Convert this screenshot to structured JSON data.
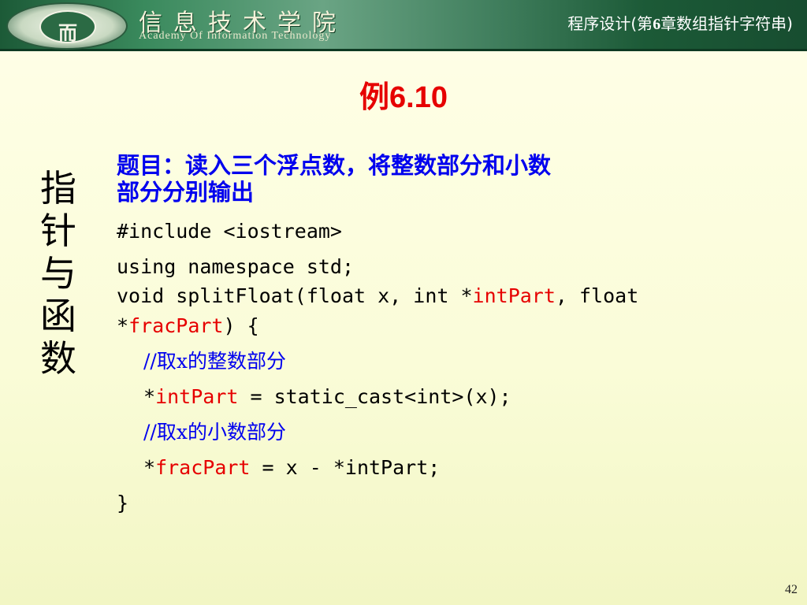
{
  "header": {
    "logo_glyph": "而",
    "school_name": "信息技术学院",
    "school_name_en": "Academy Of Information Technology",
    "chapter_prefix": "程序设计(第",
    "chapter_num": "6",
    "chapter_suffix": "章数组指针字符串)"
  },
  "slide": {
    "title_cn": "例",
    "title_num": "6.10",
    "side_label": [
      "指",
      "针",
      "与",
      "函",
      "数"
    ],
    "question_line1": "题目：读入三个浮点数，将整数部分和小数",
    "question_line2": "部分分别输出",
    "code": {
      "l1": "#include <iostream>",
      "l2": "using namespace std;",
      "l3a": "void splitFloat(float x, int *",
      "l3b": "intPart",
      "l3c": ", float",
      "l4a": "*",
      "l4b": "fracPart",
      "l4c": ") {",
      "l5": "//取x的整数部分",
      "l6a": "*",
      "l6b": "intPart",
      "l6c": " = static_cast<int>(x);",
      "l7": "//取x的小数部分",
      "l8a": "*",
      "l8b": "fracPart",
      "l8c": " = x - *intPart;",
      "l9": "}"
    },
    "page_number": "42"
  },
  "colors": {
    "title": "#e60000",
    "question": "#0000ee",
    "highlight": "#e60000",
    "header_green": "#1c5a37"
  }
}
